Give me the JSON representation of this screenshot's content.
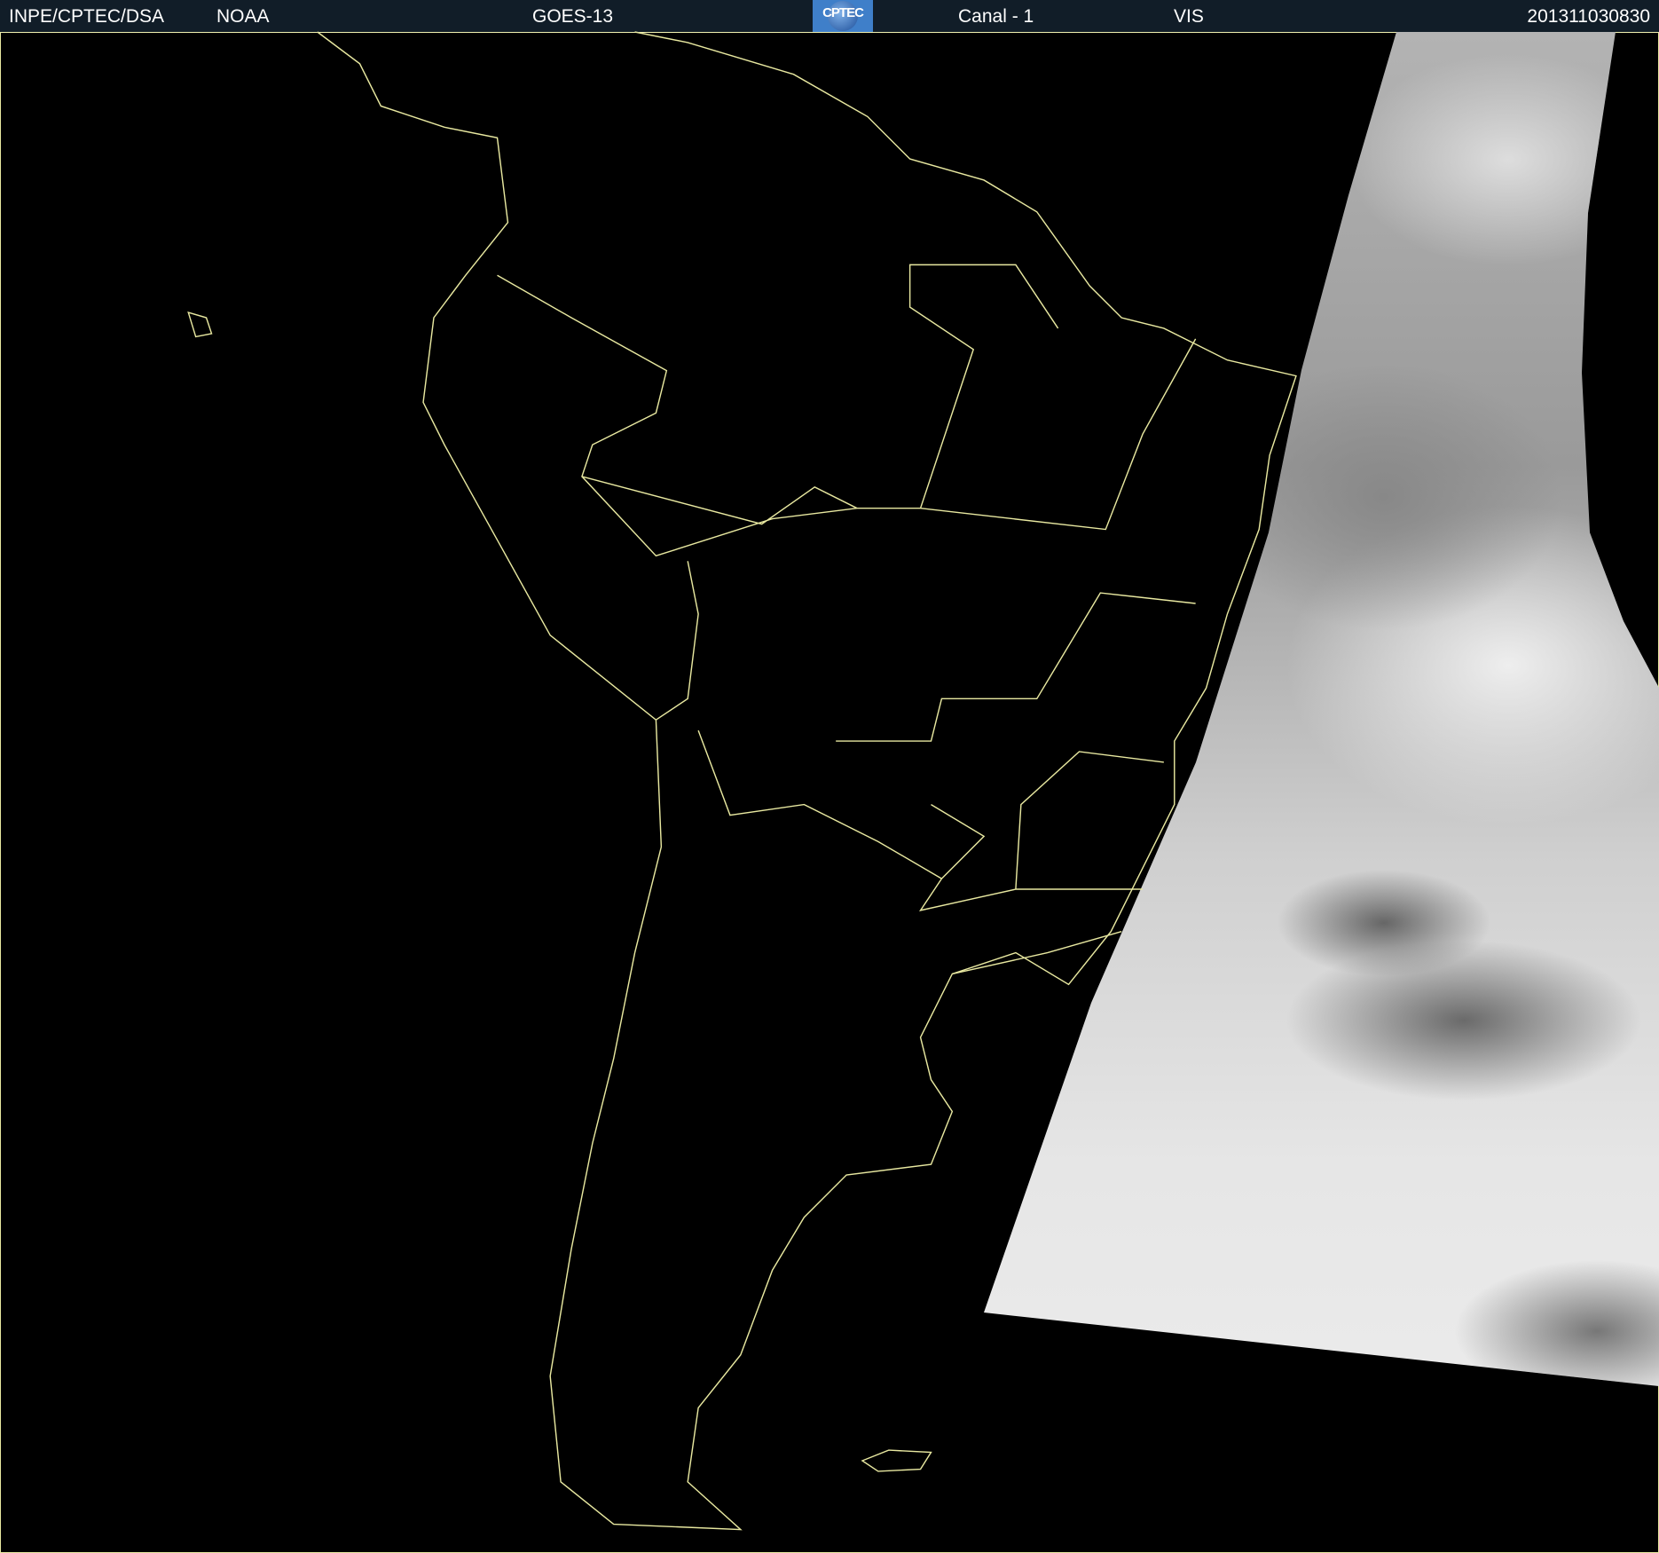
{
  "header": {
    "institution": "INPE/CPTEC/DSA",
    "agency": "NOAA",
    "satellite": "GOES-13",
    "logo_text": "CPTEC",
    "channel": "Canal - 1",
    "band": "VIS",
    "timestamp": "201311030830"
  },
  "colors": {
    "header_bg": "#111d28",
    "coastline": "#e8e8a0"
  }
}
